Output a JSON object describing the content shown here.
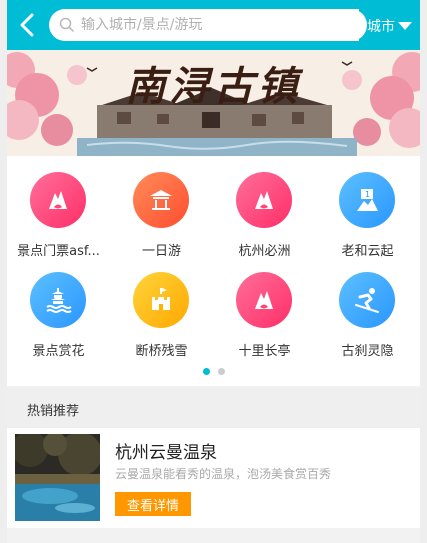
{
  "header": {
    "search_placeholder": "输入城市/景点/游玩",
    "city_label": "城市"
  },
  "banner": {
    "title": "南浔古镇"
  },
  "categories": [
    {
      "label": "景点门票asf...",
      "icon": "mountain-icon",
      "color": "pink"
    },
    {
      "label": "一日游",
      "icon": "pavilion-icon",
      "color": "orange"
    },
    {
      "label": "杭州必洲",
      "icon": "mountain-icon",
      "color": "pink"
    },
    {
      "label": "老和云起",
      "icon": "flag-mountain-icon",
      "color": "blue"
    },
    {
      "label": "景点赏花",
      "icon": "pagoda-icon",
      "color": "blue"
    },
    {
      "label": "断桥残雪",
      "icon": "castle-icon",
      "color": "yellow"
    },
    {
      "label": "十里长亭",
      "icon": "mountain-icon",
      "color": "pink"
    },
    {
      "label": "古刹灵隐",
      "icon": "skier-icon",
      "color": "blue"
    }
  ],
  "pager": {
    "pages": 2,
    "active": 1
  },
  "hot": {
    "title": "热销推荐",
    "items": [
      {
        "name": "杭州云曼温泉",
        "desc": "云曼温泉能看秀的温泉，泡汤美食赏百秀",
        "button": "查看详情"
      }
    ]
  },
  "colors": {
    "accent": "#00bcd4",
    "pink": "#ff3f74",
    "orange": "#ff6a3d",
    "blue": "#30a8ff",
    "yellow": "#ffbf1a",
    "button": "#ff9800"
  }
}
